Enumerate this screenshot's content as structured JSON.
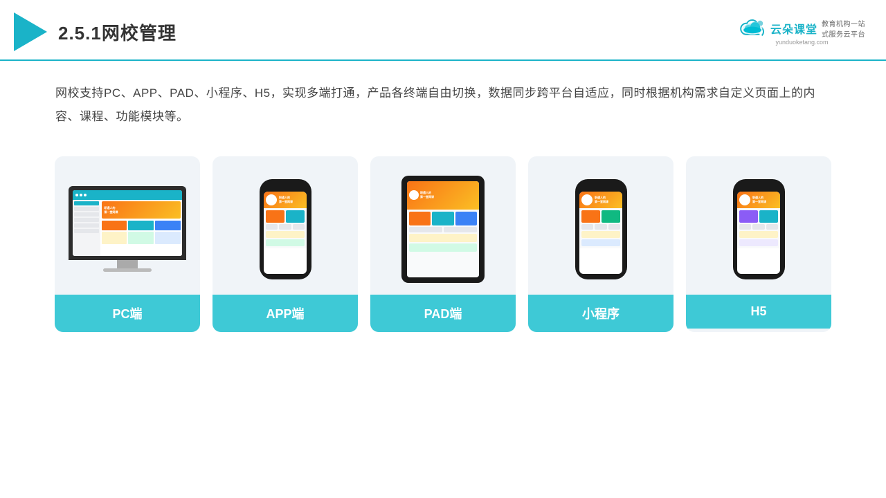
{
  "header": {
    "title": "2.5.1网校管理",
    "brand_name": "云朵课堂",
    "brand_url": "yunduoketang.com",
    "brand_slogan_line1": "教育机构一站",
    "brand_slogan_line2": "式服务云平台"
  },
  "description": {
    "text": "网校支持PC、APP、PAD、小程序、H5，实现多端打通，产品各终端自由切换，数据同步跨平台自适应，同时根据机构需求自定义页面上的内容、课程、功能模块等。"
  },
  "devices": [
    {
      "id": "pc",
      "label": "PC端",
      "type": "pc"
    },
    {
      "id": "app",
      "label": "APP端",
      "type": "phone"
    },
    {
      "id": "pad",
      "label": "PAD端",
      "type": "tablet"
    },
    {
      "id": "miniapp",
      "label": "小程序",
      "type": "phone"
    },
    {
      "id": "h5",
      "label": "H5",
      "type": "phone"
    }
  ],
  "colors": {
    "teal": "#3ec9d6",
    "accent": "#1ab3c8",
    "orange": "#f97316"
  }
}
